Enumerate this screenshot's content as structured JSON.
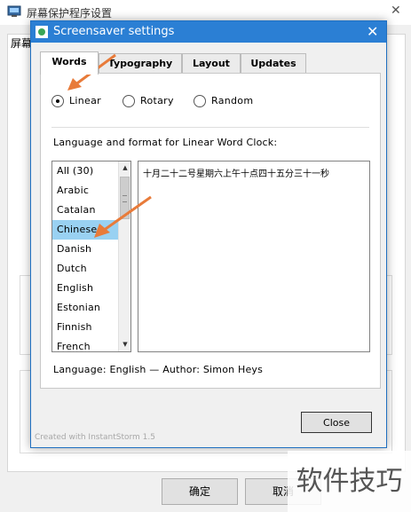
{
  "background_window": {
    "title": "屏幕保护程序设置",
    "tab_label": "屏幕",
    "ok_label": "确定",
    "cancel_label": "取消",
    "close_glyph": "✕"
  },
  "watermark": "软件技巧",
  "dialog": {
    "title": "Screensaver settings",
    "close_glyph": "✕",
    "tabs": [
      {
        "label": "Words",
        "active": true
      },
      {
        "label": "Typography",
        "active": false
      },
      {
        "label": "Layout",
        "active": false
      },
      {
        "label": "Updates",
        "active": false
      }
    ],
    "modes": [
      {
        "label": "Linear",
        "selected": true
      },
      {
        "label": "Rotary",
        "selected": false
      },
      {
        "label": "Random",
        "selected": false
      }
    ],
    "language_heading": "Language and format for Linear Word Clock:",
    "languages": [
      "All (30)",
      "Arabic",
      "Catalan",
      "Chinese",
      "Danish",
      "Dutch",
      "English",
      "Estonian",
      "Finnish",
      "French"
    ],
    "selected_language": "Chinese",
    "preview_text": "十月二十二号星期六上午十点四十五分三十一秒",
    "language_info": "Language: English — Author: Simon Heys",
    "close_button": "Close",
    "credit": "Created with InstantStorm 1.5"
  },
  "colors": {
    "titlebar": "#2b7fd4",
    "selection": "#99d1f2",
    "annotation_arrow": "#e87b3a"
  }
}
